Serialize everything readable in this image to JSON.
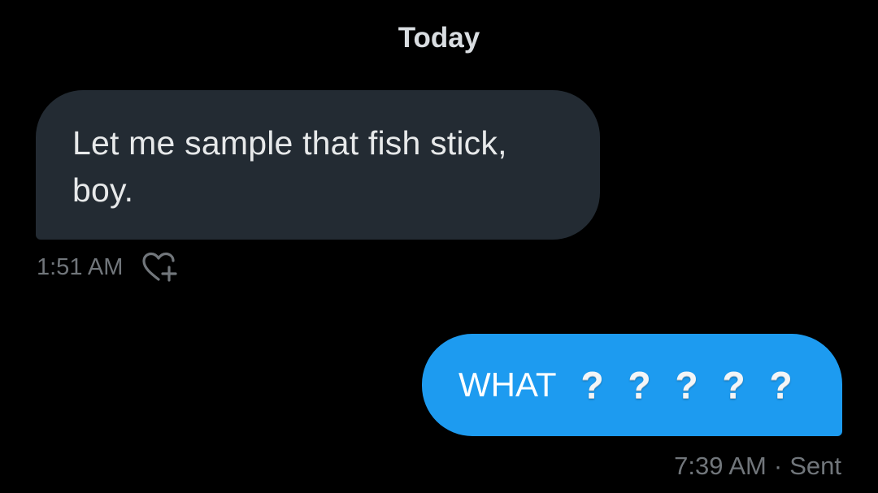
{
  "divider": {
    "label": "Today"
  },
  "messages": [
    {
      "direction": "received",
      "text": "Let me sample that fish stick, boy.",
      "time": "1:51 AM",
      "reaction_icon": "heart-plus-icon"
    },
    {
      "direction": "sent",
      "text": "WHAT",
      "emojis": [
        "?",
        "?",
        "?",
        "?",
        "?"
      ],
      "emoji_name": "white-question-mark-emoji",
      "time": "7:39 AM",
      "separator": "·",
      "status": "Sent"
    }
  ],
  "colors": {
    "background": "#000000",
    "received_bubble": "#232b33",
    "sent_bubble": "#1d9bf0",
    "meta_text": "#71767b"
  }
}
